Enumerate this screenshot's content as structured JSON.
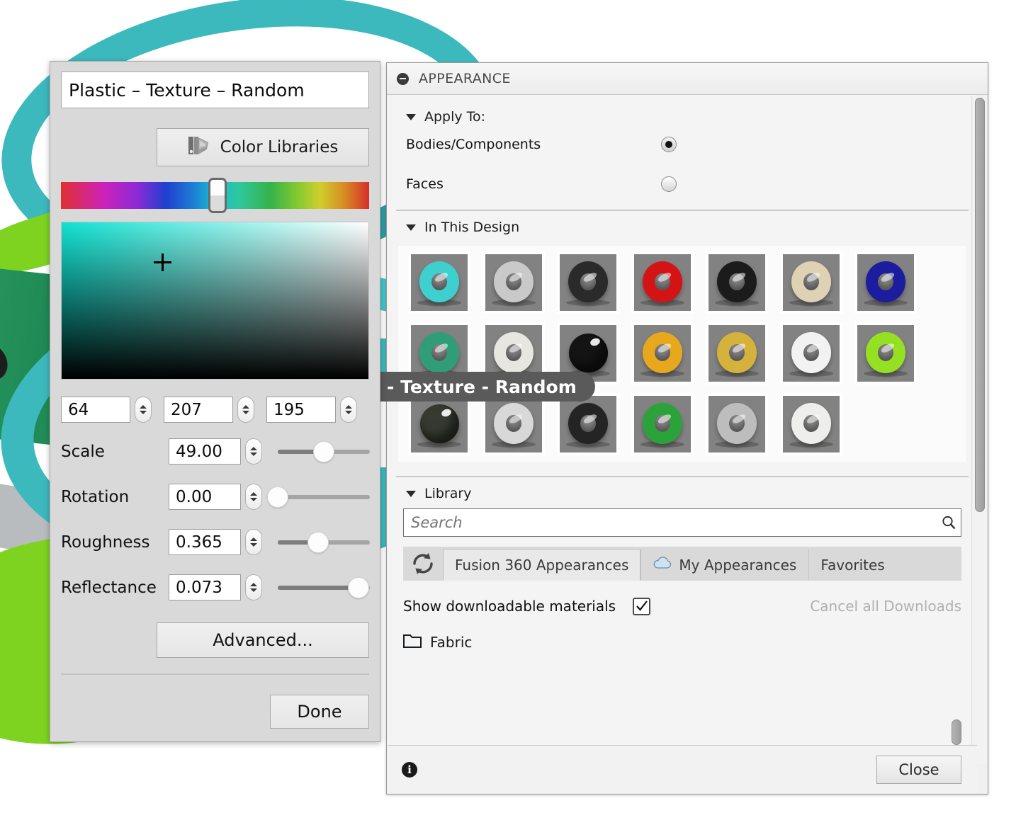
{
  "dialog": {
    "material_name": "Plastic – Texture – Random",
    "color_libraries_label": "Color Libraries",
    "color_libraries_icon": "color-swatch-fan-icon",
    "rgb": {
      "r": "64",
      "g": "207",
      "b": "195"
    },
    "sliders": [
      {
        "label": "Scale",
        "value": "49.00",
        "percent": 50
      },
      {
        "label": "Rotation",
        "value": "0.00",
        "percent": 0
      },
      {
        "label": "Roughness",
        "value": "0.365",
        "percent": 44
      },
      {
        "label": "Reflectance",
        "value": "0.073",
        "percent": 88
      }
    ],
    "advanced_label": "Advanced...",
    "done_label": "Done",
    "picker_color_hex": "#10e2d2"
  },
  "tooltip": {
    "text": "- Texture - Random"
  },
  "panel": {
    "title": "APPEARANCE",
    "collapse_icon": "minus-circle-icon",
    "apply_to": {
      "title": "Apply To:",
      "options": [
        {
          "label": "Bodies/Components",
          "selected": true
        },
        {
          "label": "Faces",
          "selected": false
        }
      ]
    },
    "in_this_design": {
      "title": "In This Design",
      "thumbnails": [
        [
          {
            "name": "plastic-texture-random-teal",
            "shape": "torus",
            "color": "#3ecfcf",
            "selected": true
          },
          {
            "name": "chrome-polished",
            "shape": "torus",
            "color": "#c9c9c9"
          },
          {
            "name": "plastic-matte-black",
            "shape": "torus",
            "color": "#2a2a2a"
          },
          {
            "name": "plastic-glossy-red",
            "shape": "torus",
            "color": "#d41414"
          },
          {
            "name": "plastic-matte-dark",
            "shape": "torus",
            "color": "#1b1b1b"
          },
          {
            "name": "plastic-beige",
            "shape": "torus",
            "color": "#ded1b4"
          },
          {
            "name": "plastic-glossy-blue",
            "shape": "torus",
            "color": "#1c1c9e"
          }
        ],
        [
          {
            "name": "plastic-translucent-green",
            "shape": "torus",
            "color": "#2f9e78"
          },
          {
            "name": "plastic-white-matte",
            "shape": "torus",
            "color": "#e8e6e0"
          },
          {
            "name": "plastic-glossy-black-sphere",
            "shape": "sphere",
            "color": "#141414"
          },
          {
            "name": "metal-gold-polished",
            "shape": "torus",
            "color": "#e8a81e"
          },
          {
            "name": "metal-brass-satin",
            "shape": "torus",
            "color": "#d4b23c"
          },
          {
            "name": "plastic-white-glossy",
            "shape": "torus",
            "color": "#f2f2f2"
          },
          {
            "name": "plastic-glossy-lime",
            "shape": "torus",
            "color": "#96e022"
          }
        ],
        [
          {
            "name": "rubber-dark-sphere",
            "shape": "sphere",
            "color": "#363a31"
          },
          {
            "name": "metal-chrome-bright",
            "shape": "torus",
            "color": "#d8d8d8"
          },
          {
            "name": "plastic-black-semigloss",
            "shape": "torus",
            "color": "#242424"
          },
          {
            "name": "plastic-glossy-green",
            "shape": "torus",
            "color": "#2ba33a"
          },
          {
            "name": "metal-steel-brushed",
            "shape": "torus",
            "color": "#bdbdbd"
          },
          {
            "name": "ceramic-white-crackle",
            "shape": "torus",
            "color": "#eeeeec"
          }
        ]
      ]
    },
    "library": {
      "title": "Library",
      "search_placeholder": "Search",
      "search_value": "",
      "search_icon": "magnifier-icon",
      "refresh_icon": "refresh-icon",
      "tabs": [
        {
          "label": "Fusion 360 Appearances",
          "active": true,
          "icon": ""
        },
        {
          "label": "My Appearances",
          "active": false,
          "icon": "cloud-icon"
        },
        {
          "label": "Favorites",
          "active": false,
          "icon": ""
        }
      ],
      "show_downloadable_label": "Show downloadable materials",
      "show_downloadable_checked": true,
      "cancel_downloads_label": "Cancel all Downloads",
      "folders": [
        {
          "label": "Fabric",
          "icon": "folder-icon"
        }
      ]
    },
    "footer": {
      "info_icon": "info-icon",
      "close_label": "Close"
    }
  }
}
